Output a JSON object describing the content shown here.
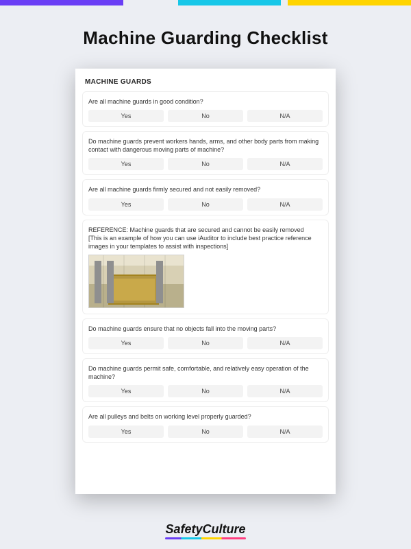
{
  "page_title": "Machine Guarding Checklist",
  "section_title": "MACHINE GUARDS",
  "options": {
    "yes": "Yes",
    "no": "No",
    "na": "N/A"
  },
  "questions": [
    {
      "text": "Are all machine guards in good condition?"
    },
    {
      "text": "Do machine guards prevent workers hands, arms, and other body parts from making contact with dangerous moving parts of machine?"
    },
    {
      "text": "Are all machine guards firmly secured and not easily removed?"
    }
  ],
  "reference": {
    "line1": "REFERENCE: Machine guards that are secured and cannot be easily removed",
    "line2": "[This is an example of how you can use iAuditor to include best practice reference images in your templates to assist with inspections]"
  },
  "questions2": [
    {
      "text": "Do machine guards ensure that no objects fall into the moving parts?"
    },
    {
      "text": "Do machine guards permit safe, comfortable, and relatively easy operation of the machine?"
    },
    {
      "text": "Are all pulleys and belts on working level properly guarded?"
    }
  ],
  "footer": {
    "brand": "SafetyCulture"
  }
}
